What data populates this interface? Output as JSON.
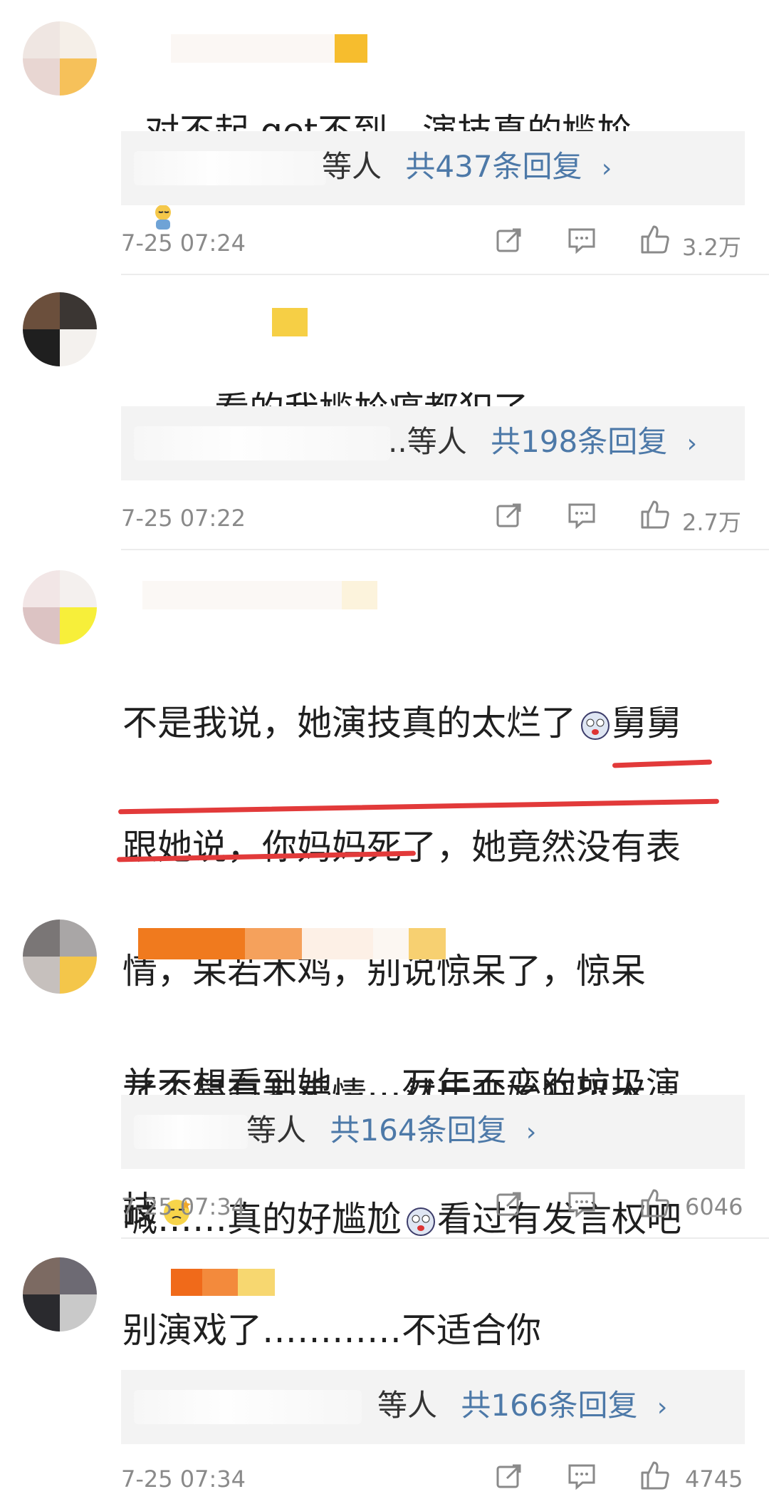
{
  "comments": [
    {
      "text": "对不起 get不到，演技真的尴尬",
      "reply_prefix": "等人",
      "reply_count": "共437条回复",
      "time": "7-25 07:24",
      "likes": "3.2万"
    },
    {
      "text": "。。。看的我尴尬癌都犯了。",
      "reply_prefix": "..等人",
      "reply_count": "共198条回复",
      "time": "7-25 07:22",
      "likes": "2.7万"
    },
    {
      "text_lines": [
        "不是我说，她演技真的太烂了",
        "跟她说，你妈妈死了，她竟然没有表",
        "情，呆若木鸡，别说惊呆了，惊呆",
        "了不是毫无表情，然后开始狂哭大",
        "喊……真的好尴尬"
      ],
      "line1_suffix": "舅舅",
      "line5_suffix": "看过有发言权吧"
    },
    {
      "text_lines": [
        "并不想看到她……万年不变的垃圾演",
        "技"
      ],
      "reply_prefix": "等人",
      "reply_count": "共164条回复",
      "time": "7-25 07:34",
      "likes": "6046"
    },
    {
      "text": "别演戏了…………不适合你",
      "reply_prefix": "等人",
      "reply_count": "共166条回复",
      "time": "7-25 07:34",
      "likes": "4745"
    }
  ],
  "icons": {
    "share": "share-icon",
    "comment": "comment-icon",
    "like": "like-icon",
    "chevron": "chevron-right-icon"
  },
  "colors": {
    "link_blue": "#4d79a8",
    "meta_gray": "#8a8a8a",
    "reply_bg": "#f3f3f3",
    "underline_red": "#e23a3a"
  }
}
